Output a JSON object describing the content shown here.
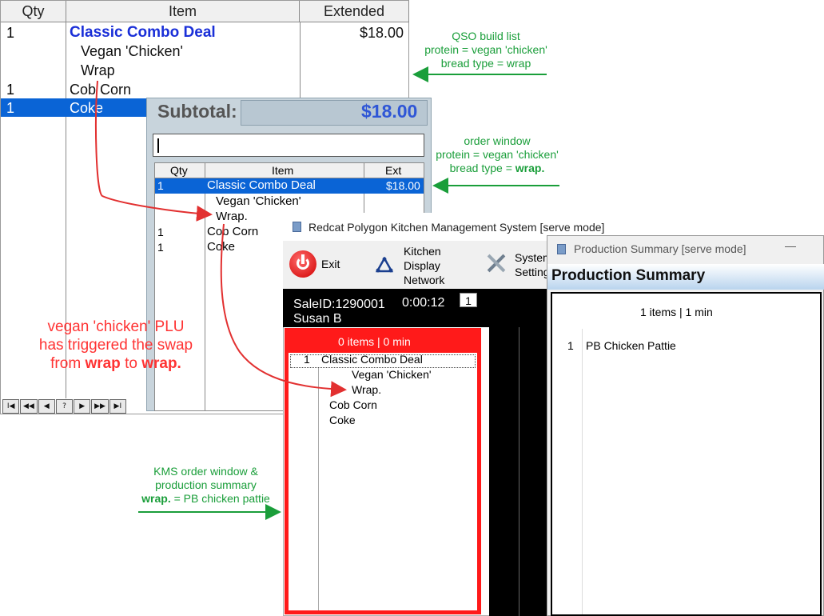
{
  "qso": {
    "headers": [
      "Qty",
      "Item",
      "Extended"
    ],
    "rows": [
      {
        "qty": "1",
        "item": "Classic Combo Deal",
        "ext": "$18.00"
      },
      {
        "qty": "",
        "item": "Vegan 'Chicken'",
        "ext": ""
      },
      {
        "qty": "",
        "item": "Wrap",
        "ext": ""
      },
      {
        "qty": "1",
        "item": "Cob Corn",
        "ext": ""
      },
      {
        "qty": "1",
        "item": "Coke",
        "ext": ""
      }
    ],
    "nav": [
      "I◀",
      "◀◀",
      "◀",
      "?",
      "▶",
      "▶▶",
      "▶I"
    ]
  },
  "order": {
    "subtotal_label": "Subtotal:",
    "subtotal_value": "$18.00",
    "headers": [
      "Qty",
      "Item",
      "Ext"
    ],
    "rows": [
      {
        "qty": "1",
        "item": "Classic Combo Deal",
        "ext": "$18.00"
      },
      {
        "qty": "",
        "item": "Vegan 'Chicken'",
        "ext": ""
      },
      {
        "qty": "",
        "item": "Wrap.",
        "ext": ""
      },
      {
        "qty": "1",
        "item": "Cob Corn",
        "ext": ""
      },
      {
        "qty": "1",
        "item": "Coke",
        "ext": ""
      }
    ]
  },
  "kms": {
    "title": "Redcat Polygon Kitchen Management System [serve mode]",
    "exit_label": "Exit",
    "kdn_line1": "Kitchen",
    "kdn_line2": "Display",
    "kdn_line3": "Network",
    "settings_line1": "System",
    "settings_line2": "Settings",
    "sale_id": "SaleID:1290001",
    "timer": "0:00:12",
    "badge": "1",
    "customer": "Susan B",
    "order_summary": "0 items |    0 min",
    "rows": [
      {
        "qty": "1",
        "item": "Classic Combo Deal"
      },
      {
        "qty": "",
        "item": "Vegan 'Chicken'"
      },
      {
        "qty": "",
        "item": "Wrap."
      },
      {
        "qty": "",
        "item": "Cob Corn"
      },
      {
        "qty": "",
        "item": "Coke"
      }
    ]
  },
  "prod": {
    "window_title": "Production Summary [serve mode]",
    "minimize_glyph": "—",
    "heading": "Production Summary",
    "summary": "1 items |    1 min",
    "rows": [
      {
        "qty": "1",
        "item": "PB Chicken Pattie"
      }
    ]
  },
  "annotations": {
    "qso_l1": "QSO build list",
    "qso_l2": "protein = vegan 'chicken'",
    "qso_l3": "bread type = wrap",
    "ow_l1": "order window",
    "ow_l2": "protein = vegan 'chicken'",
    "ow_l3a": "bread type = ",
    "ow_l3b": "wrap.",
    "red_l1": "vegan 'chicken' PLU",
    "red_l2": "has triggered the swap",
    "red_l3a": "from ",
    "red_l3b": "wrap",
    "red_l3c": " to ",
    "red_l3d": "wrap.",
    "kms_l1": "KMS order window &",
    "kms_l2": "production summary",
    "kms_l3a": "wrap.",
    "kms_l3b": " = PB chicken pattie"
  },
  "colors": {
    "annotation_green": "#1a9e3a",
    "annotation_red": "#ff3333",
    "selection_blue": "#0a64d6",
    "kms_red": "#ff1a1a"
  }
}
